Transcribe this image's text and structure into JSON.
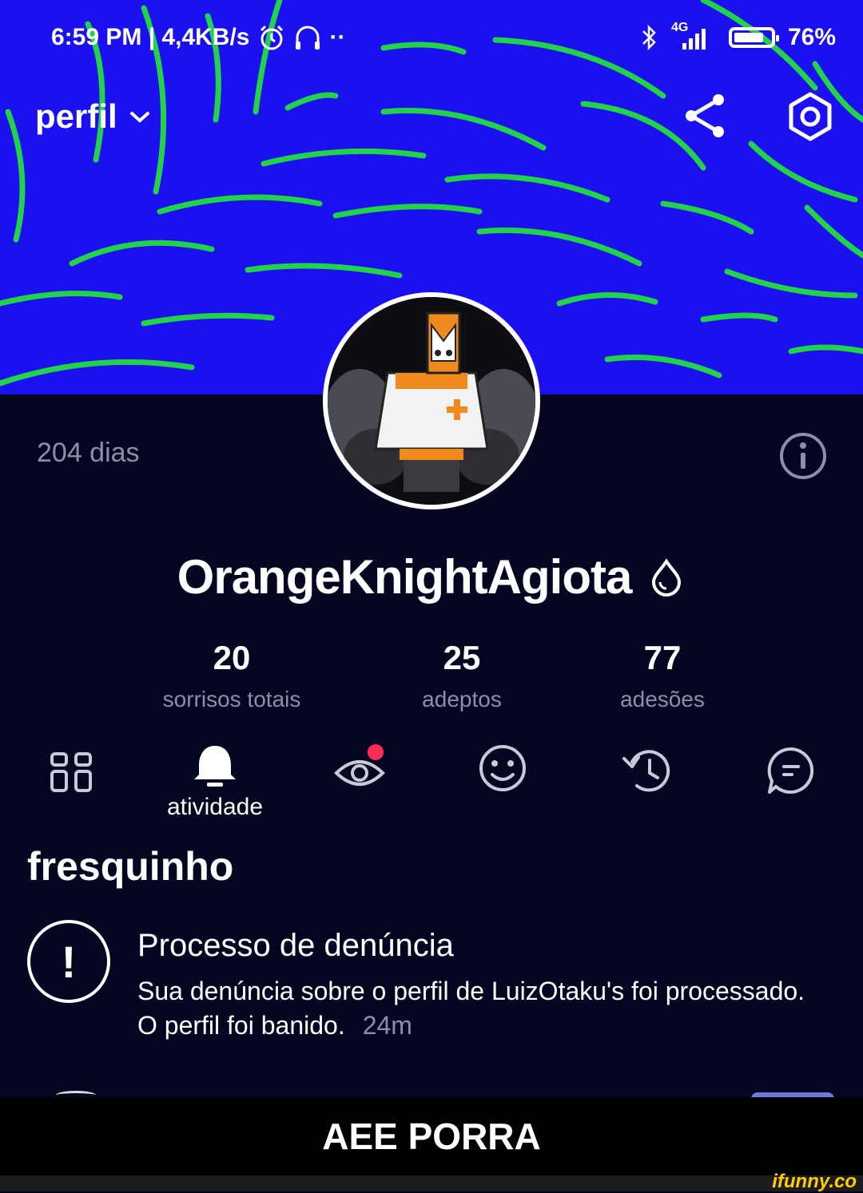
{
  "status_bar": {
    "time_speed": "6:59 PM | 4,4KB/s",
    "network": "4G",
    "battery": "76%"
  },
  "header": {
    "title": "perfil"
  },
  "profile": {
    "days": "204 dias",
    "username": "OrangeKnightAgiota",
    "stats": [
      {
        "value": "20",
        "label": "sorrisos totais"
      },
      {
        "value": "25",
        "label": "adeptos"
      },
      {
        "value": "77",
        "label": "adesões"
      }
    ]
  },
  "tabs": {
    "active_label": "atividade"
  },
  "feed": {
    "section_title": "fresquinho",
    "notification": {
      "icon_text": "!",
      "title": "Processo de denúncia",
      "body": "Sua denúncia sobre o perfil de LuizOtaku's foi processado. O perfil foi banido.",
      "time": "24m"
    }
  },
  "caption": "AEE PORRA",
  "watermark": "ifunny.co",
  "colors": {
    "banner": "#1a10f0",
    "wave": "#22d34a",
    "background": "#040521",
    "muted_text": "#8c8fa8",
    "notification_dot": "#ff2d55",
    "avatar_orange": "#f08a1c"
  }
}
